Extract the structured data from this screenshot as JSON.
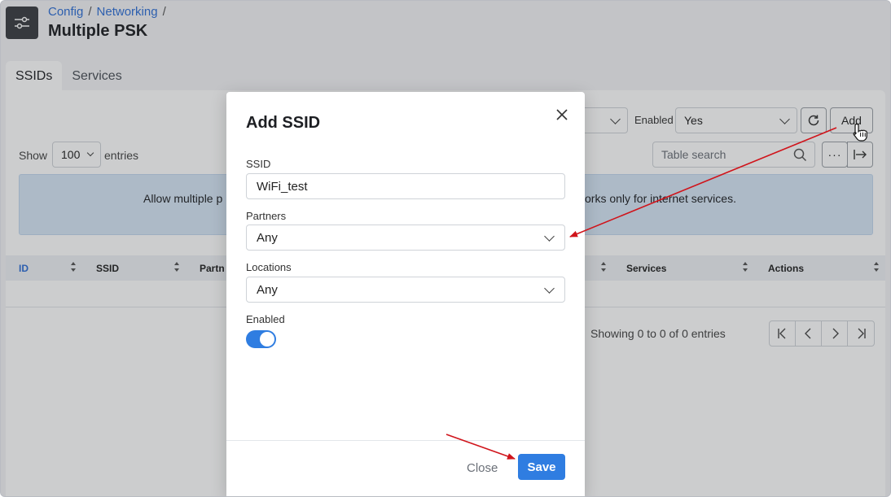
{
  "breadcrumb": [
    "Config",
    "Networking"
  ],
  "page_title": "Multiple PSK",
  "tabs": [
    {
      "label": "SSIDs",
      "active": true
    },
    {
      "label": "Services",
      "active": false
    }
  ],
  "toolbar": {
    "enabled_label": "Enabled",
    "enabled_value": "Yes",
    "add_label": "Add",
    "search_placeholder": "Table search"
  },
  "entries": {
    "show_label": "Show",
    "value": "100",
    "suffix": "entries"
  },
  "info_banner": {
    "left_text": "Allow multiple p",
    "right_text": "vorks only for internet services."
  },
  "table": {
    "columns": [
      "ID",
      "SSID",
      "Partn",
      "Services",
      "Actions"
    ]
  },
  "pagination": {
    "summary": "Showing 0 to 0 of 0 entries"
  },
  "modal": {
    "title": "Add SSID",
    "ssid_label": "SSID",
    "ssid_value": "WiFi_test",
    "partners_label": "Partners",
    "partners_value": "Any",
    "locations_label": "Locations",
    "locations_value": "Any",
    "enabled_label": "Enabled",
    "enabled_on": true,
    "close_label": "Close",
    "save_label": "Save"
  },
  "colors": {
    "accent": "#2f7de1",
    "link": "#2f6fd6",
    "annotation_arrow": "#d0141b"
  }
}
